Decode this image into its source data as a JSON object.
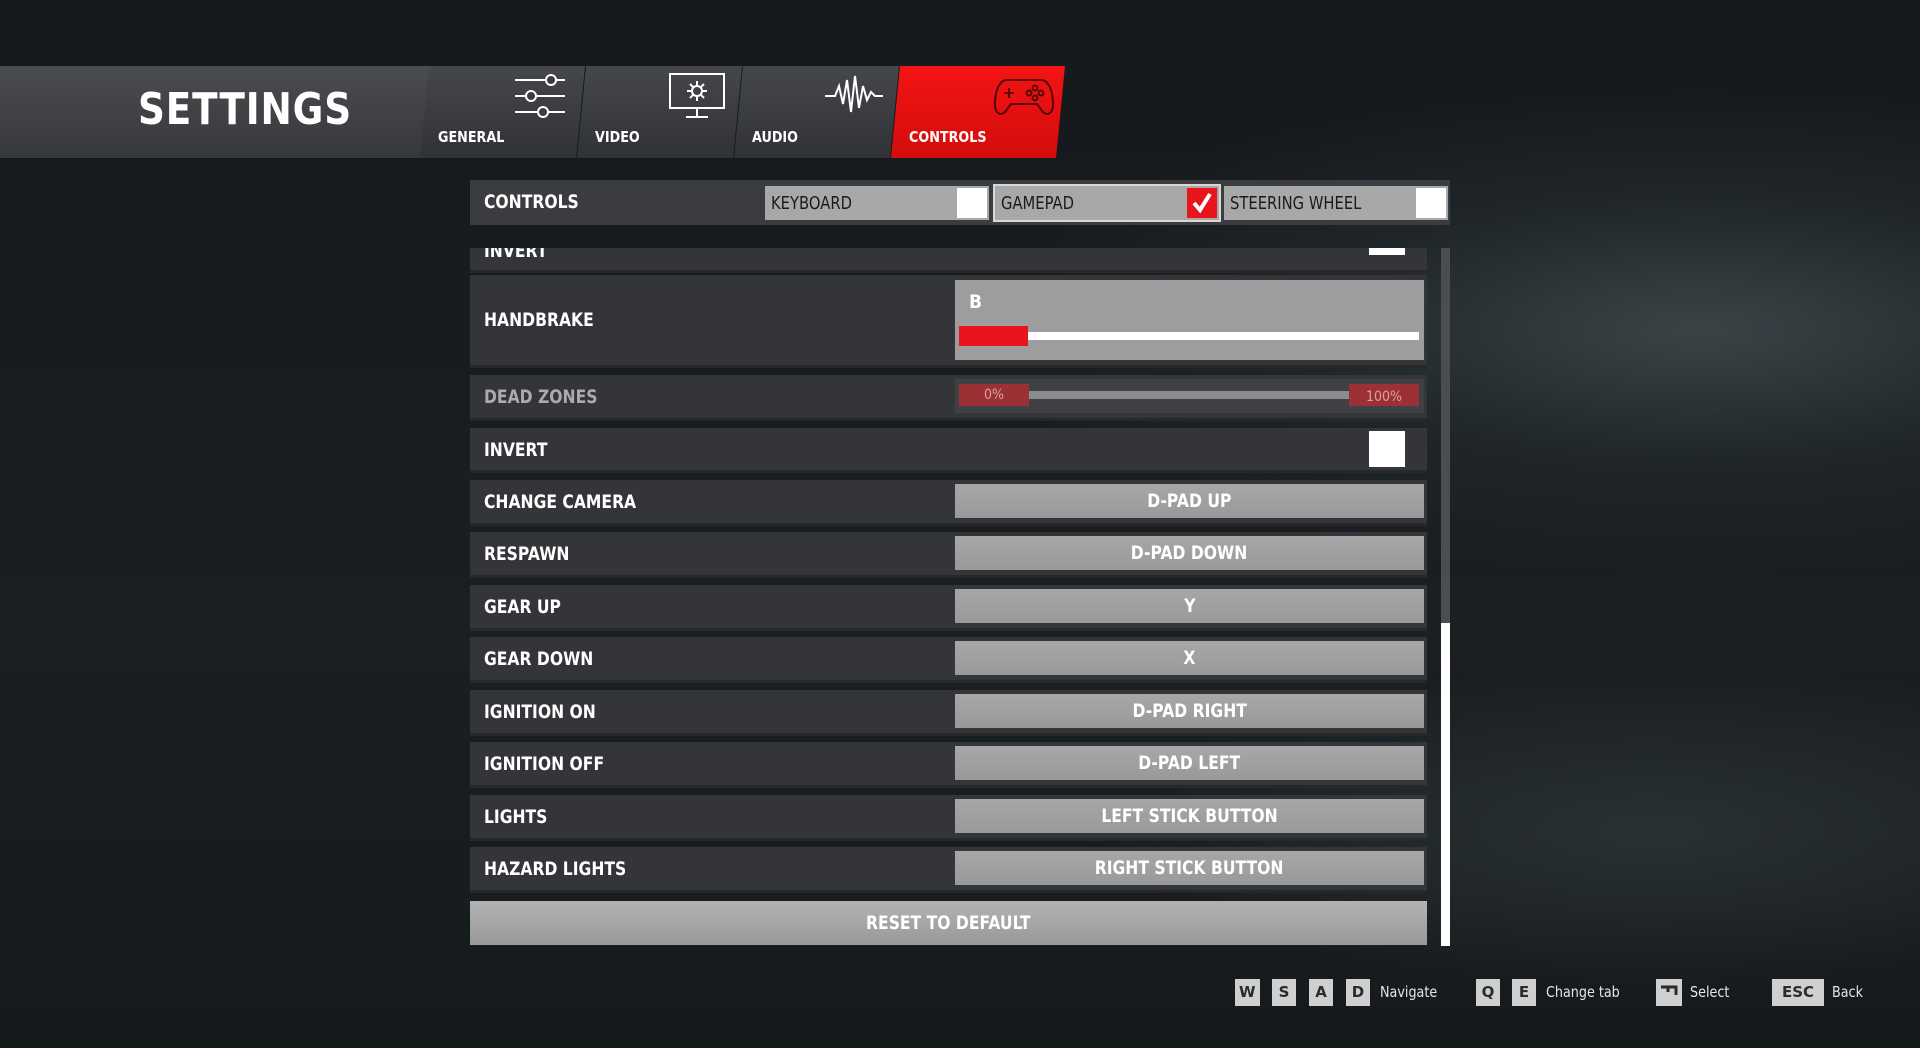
{
  "header": {
    "title": "SETTINGS",
    "tabs": [
      {
        "label": "GENERAL",
        "icon": "sliders-icon",
        "active": false
      },
      {
        "label": "VIDEO",
        "icon": "monitor-gear-icon",
        "active": false
      },
      {
        "label": "AUDIO",
        "icon": "waveform-icon",
        "active": false
      },
      {
        "label": "CONTROLS",
        "icon": "gamepad-icon",
        "active": true
      }
    ]
  },
  "controls_bar": {
    "label": "CONTROLS",
    "devices": [
      {
        "label": "KEYBOARD",
        "checked": false
      },
      {
        "label": "GAMEPAD",
        "checked": true
      },
      {
        "label": "STEERING WHEEL",
        "checked": false
      }
    ]
  },
  "rows": {
    "invert_top": {
      "label": "INVERT"
    },
    "handbrake": {
      "label": "HANDBRAKE",
      "binding": "B",
      "level": 0.15
    },
    "dead_zones": {
      "label": "DEAD ZONES",
      "min_label": "0%",
      "max_label": "100%"
    },
    "invert": {
      "label": "INVERT",
      "checked": false
    },
    "bindings": [
      {
        "label": "CHANGE CAMERA",
        "binding": "D-PAD UP"
      },
      {
        "label": "RESPAWN",
        "binding": "D-PAD DOWN"
      },
      {
        "label": "GEAR UP",
        "binding": "Y"
      },
      {
        "label": "GEAR DOWN",
        "binding": "X"
      },
      {
        "label": "IGNITION ON",
        "binding": "D-PAD RIGHT"
      },
      {
        "label": "IGNITION OFF",
        "binding": "D-PAD LEFT"
      },
      {
        "label": "LIGHTS",
        "binding": "LEFT STICK BUTTON"
      },
      {
        "label": "HAZARD LIGHTS",
        "binding": "RIGHT STICK BUTTON"
      }
    ]
  },
  "reset_label": "RESET TO DEFAULT",
  "hints": {
    "nav_keys": [
      "W",
      "S",
      "A",
      "D"
    ],
    "nav_label": "Navigate",
    "tab_keys": [
      "Q",
      "E"
    ],
    "tab_label": "Change tab",
    "select_icon": "enter-key-icon",
    "select_label": "Select",
    "back_key": "ESC",
    "back_label": "Back"
  },
  "colors": {
    "accent": "#e8151d",
    "panel": "#333538",
    "button": "#a3a3a3"
  }
}
